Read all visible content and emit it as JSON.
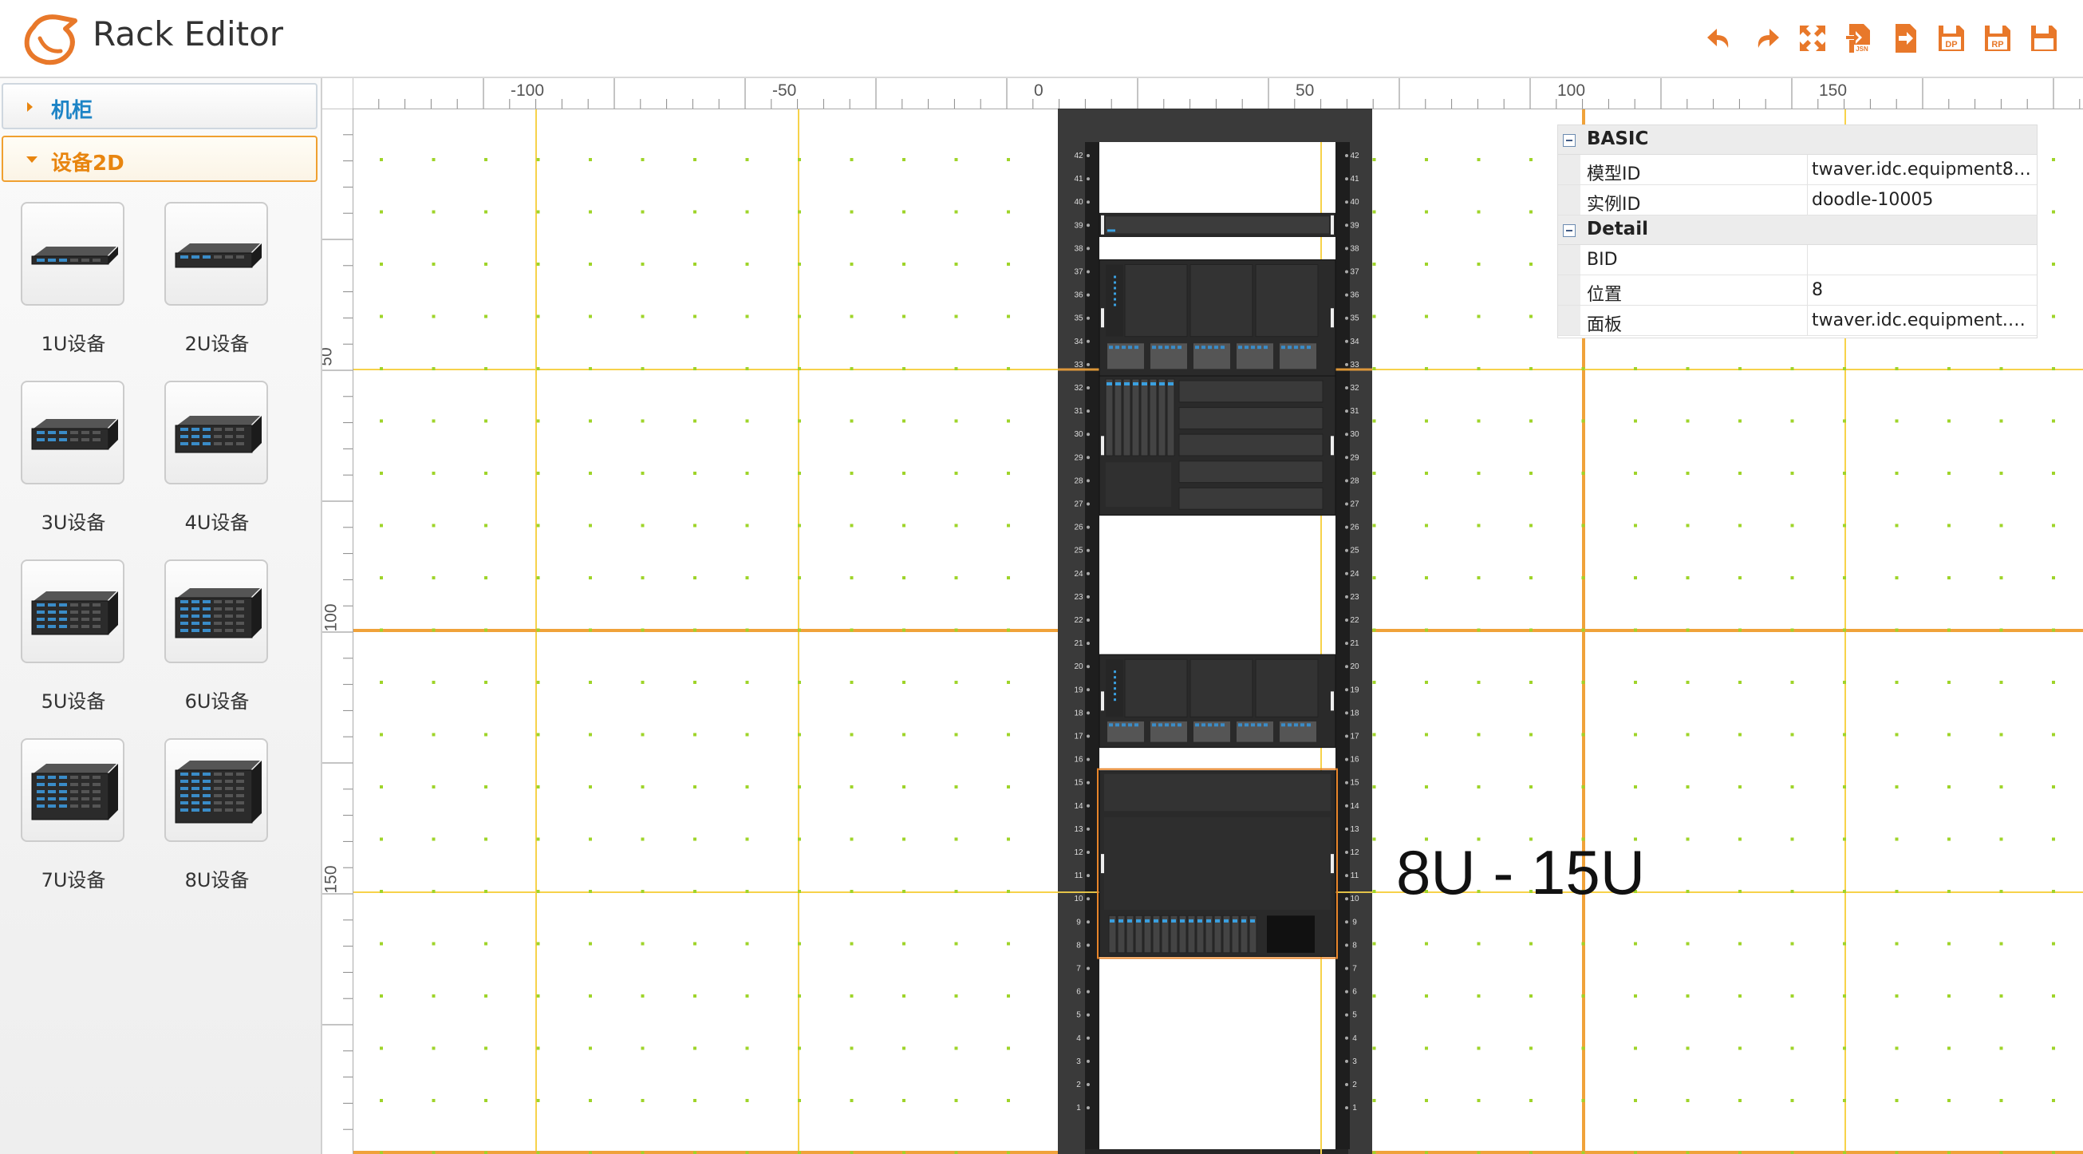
{
  "header": {
    "app_title": "Rack Editor",
    "toolbar": [
      {
        "name": "undo",
        "icon": "undo-icon"
      },
      {
        "name": "redo",
        "icon": "redo-icon"
      },
      {
        "name": "fit",
        "icon": "fit-screen-icon"
      },
      {
        "name": "import-json",
        "icon": "import-json-icon",
        "text": "JSN"
      },
      {
        "name": "export",
        "icon": "export-icon"
      },
      {
        "name": "save-dp",
        "icon": "file-dp-icon",
        "text": "DP"
      },
      {
        "name": "save-rp",
        "icon": "file-rp-icon",
        "text": "RP"
      },
      {
        "name": "save",
        "icon": "save-icon"
      }
    ],
    "accent_color": "#e8782a"
  },
  "sidebar": {
    "accordion": [
      {
        "label": "机柜",
        "expanded": false
      },
      {
        "label": "设备2D",
        "expanded": true
      }
    ],
    "devices": [
      {
        "label": "1U设备",
        "units": 1
      },
      {
        "label": "2U设备",
        "units": 2
      },
      {
        "label": "3U设备",
        "units": 3
      },
      {
        "label": "4U设备",
        "units": 4
      },
      {
        "label": "5U设备",
        "units": 5
      },
      {
        "label": "6U设备",
        "units": 6
      },
      {
        "label": "7U设备",
        "units": 7
      },
      {
        "label": "8U设备",
        "units": 8
      }
    ]
  },
  "canvas": {
    "hruler_labels": [
      "-100",
      "-50",
      "0",
      "50",
      "100",
      "150"
    ],
    "vruler_labels": [
      "50",
      "100",
      "150"
    ],
    "rack_unit_numbers": [
      "42",
      "41",
      "40",
      "39",
      "38",
      "37",
      "36",
      "35",
      "34",
      "33",
      "32",
      "31",
      "30",
      "29",
      "28",
      "27",
      "26",
      "25",
      "24",
      "23",
      "22",
      "21",
      "20",
      "19",
      "18",
      "17",
      "16",
      "15",
      "14",
      "13",
      "12",
      "11",
      "10",
      "9",
      "8",
      "7",
      "6",
      "5",
      "4",
      "3",
      "2",
      "1"
    ],
    "selection_label": "8U - 15U"
  },
  "properties": {
    "groups": [
      {
        "title": "BASIC",
        "rows": [
          {
            "key": "模型ID",
            "value": "twaver.idc.equipment8.f..."
          },
          {
            "key": "实例ID",
            "value": "doodle-10005"
          }
        ]
      },
      {
        "title": "Detail",
        "rows": [
          {
            "key": "BID",
            "value": ""
          },
          {
            "key": "位置",
            "value": "8"
          },
          {
            "key": "面板",
            "value": "twaver.idc.equipment.ne..."
          }
        ]
      }
    ]
  }
}
